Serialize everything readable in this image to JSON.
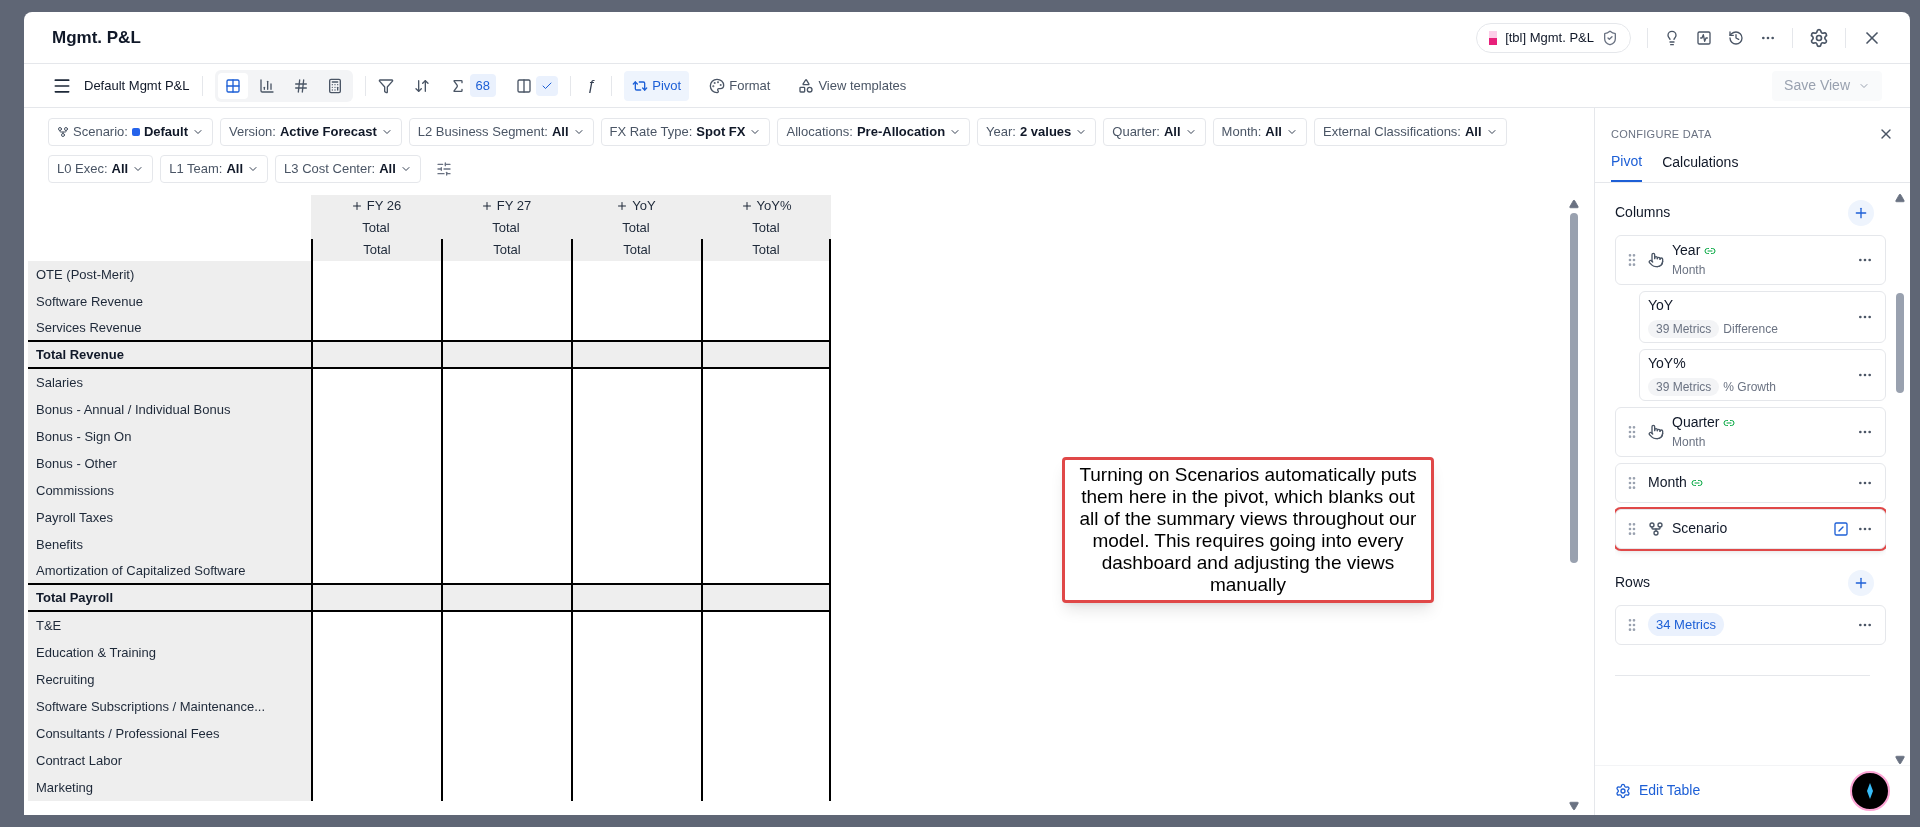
{
  "window": {
    "title": "Mgmt. P&L"
  },
  "header_badge": {
    "label": "[tbl] Mgmt. P&L"
  },
  "toolbar": {
    "view_name": "Default Mgmt P&L",
    "view_modes": [
      {
        "kind": "table",
        "selected": true
      },
      {
        "kind": "chart",
        "selected": false
      },
      {
        "kind": "number",
        "selected": false
      },
      {
        "kind": "calculator",
        "selected": false
      }
    ],
    "metric_count": "68",
    "function_symbol": "ƒ",
    "buttons": [
      {
        "kind": "pivot",
        "label": "Pivot",
        "selected": true
      },
      {
        "kind": "format",
        "label": "Format",
        "selected": false
      },
      {
        "kind": "templates",
        "label": "View templates",
        "selected": false
      }
    ],
    "save_view": {
      "label": "Save View",
      "disabled": true
    }
  },
  "filters": [
    {
      "kind": "scenario",
      "label": "Scenario:",
      "value": "Default",
      "color": "#2563eb"
    },
    {
      "label": "Version:",
      "value": "Active Forecast"
    },
    {
      "label": "L2 Business Segment:",
      "value": "All"
    },
    {
      "label": "FX Rate Type:",
      "value": "Spot FX"
    },
    {
      "label": "Allocations:",
      "value": "Pre-Allocation"
    },
    {
      "label": "Year:",
      "value": "2 values"
    },
    {
      "label": "Quarter:",
      "value": "All"
    },
    {
      "label": "Month:",
      "value": "All"
    },
    {
      "label": "External Classifications:",
      "value": "All"
    },
    {
      "label": "L0 Exec:",
      "value": "All"
    },
    {
      "label": "L1 Team:",
      "value": "All"
    },
    {
      "label": "L3 Cost Center:",
      "value": "All"
    }
  ],
  "table": {
    "columns": [
      {
        "label": "FY 26",
        "sub_1": "Total",
        "sub_2": "Total"
      },
      {
        "label": "FY 27",
        "sub_1": "Total",
        "sub_2": "Total"
      },
      {
        "label": "YoY",
        "sub_1": "Total",
        "sub_2": "Total"
      },
      {
        "label": "YoY%",
        "sub_1": "Total",
        "sub_2": "Total"
      }
    ],
    "rows": [
      {
        "label": "OTE (Post-Merit)",
        "kind": "item"
      },
      {
        "label": "Software Revenue",
        "kind": "item"
      },
      {
        "label": "Services Revenue",
        "kind": "item"
      },
      {
        "label": "Total Revenue",
        "kind": "total"
      },
      {
        "label": "Salaries",
        "kind": "item"
      },
      {
        "label": "Bonus - Annual / Individual Bonus",
        "kind": "item"
      },
      {
        "label": "Bonus - Sign On",
        "kind": "item"
      },
      {
        "label": "Bonus - Other",
        "kind": "item"
      },
      {
        "label": "Commissions",
        "kind": "item"
      },
      {
        "label": "Payroll Taxes",
        "kind": "item"
      },
      {
        "label": "Benefits",
        "kind": "item"
      },
      {
        "label": "Amortization of Capitalized Software",
        "kind": "item"
      },
      {
        "label": "Total Payroll",
        "kind": "total"
      },
      {
        "label": "T&E",
        "kind": "item"
      },
      {
        "label": "Education & Training",
        "kind": "item"
      },
      {
        "label": "Recruiting",
        "kind": "item"
      },
      {
        "label": "Software Subscriptions / Maintenance...",
        "kind": "item"
      },
      {
        "label": "Consultants / Professional Fees",
        "kind": "item"
      },
      {
        "label": "Contract Labor",
        "kind": "item"
      },
      {
        "label": "Marketing",
        "kind": "item"
      }
    ]
  },
  "annotation": {
    "text": "Turning on Scenarios automatically puts them here in the pivot, which blanks out all of the summary views throughout our model. This requires going into every dashboard and adjusting the views manually"
  },
  "panel": {
    "title": "CONFIGURE DATA",
    "tabs": [
      {
        "label": "Pivot",
        "selected": true
      },
      {
        "label": "Calculations",
        "selected": false
      }
    ],
    "sections": [
      {
        "title": "Columns",
        "items": [
          {
            "kind": "dimension",
            "label": "Year",
            "sublabel": "Month",
            "linked": true,
            "highlighted": false,
            "children": [
              {
                "label": "YoY",
                "chip": "39 Metrics",
                "note": "Difference"
              },
              {
                "label": "YoY%",
                "chip": "39 Metrics",
                "note": "% Growth"
              }
            ]
          },
          {
            "kind": "dimension",
            "label": "Quarter",
            "sublabel": "Month",
            "linked": true,
            "highlighted": false
          },
          {
            "kind": "plain",
            "label": "Month",
            "linked": true,
            "highlighted": false
          },
          {
            "kind": "scenario",
            "label": "Scenario",
            "linked": false,
            "hidden": true,
            "highlighted": true
          }
        ]
      },
      {
        "title": "Rows",
        "items": [
          {
            "kind": "metrics",
            "chip": "34 Metrics",
            "highlighted": false
          }
        ]
      }
    ],
    "footer": "Edit Table"
  }
}
